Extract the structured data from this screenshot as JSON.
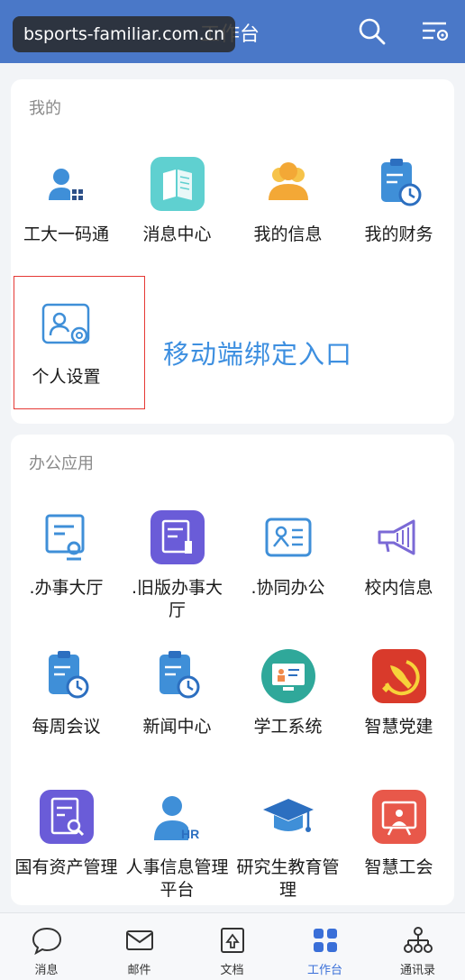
{
  "header": {
    "title": "工作台",
    "watermark": "bsports-familiar.com.cn"
  },
  "my_section": {
    "title": "我的",
    "apps": [
      {
        "label": "工大一码通"
      },
      {
        "label": "消息中心"
      },
      {
        "label": "我的信息"
      },
      {
        "label": "我的财务"
      },
      {
        "label": "个人设置"
      }
    ],
    "annotation": "移动端绑定入口"
  },
  "office_section": {
    "title": "办公应用",
    "apps": [
      {
        "label": ".办事大厅"
      },
      {
        "label": ".旧版办事大厅"
      },
      {
        "label": ".协同办公"
      },
      {
        "label": "校内信息"
      },
      {
        "label": "每周会议"
      },
      {
        "label": "新闻中心"
      },
      {
        "label": "学工系统"
      },
      {
        "label": "智慧党建"
      },
      {
        "label": "国有资产管理"
      },
      {
        "label": "人事信息管理平台"
      },
      {
        "label": "研究生教育管理"
      },
      {
        "label": "智慧工会"
      }
    ]
  },
  "nav": {
    "items": [
      {
        "label": "消息"
      },
      {
        "label": "邮件"
      },
      {
        "label": "文档"
      },
      {
        "label": "工作台"
      },
      {
        "label": "通讯录"
      }
    ]
  },
  "colors": {
    "header_bg": "#4a78c8",
    "accent_blue": "#3d8fe0",
    "highlight_red": "#e53935",
    "active_nav": "#3a6fd8"
  }
}
